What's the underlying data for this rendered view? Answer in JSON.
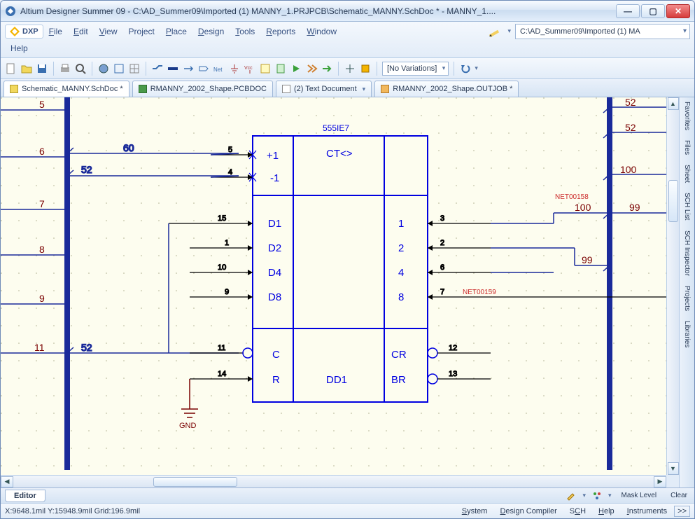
{
  "window": {
    "title": "Altium Designer Summer 09 - C:\\AD_Summer09\\Imported (1) MANNY_1.PRJPCB\\Schematic_MANNY.SchDoc * - MANNY_1...."
  },
  "menus": {
    "dxp": "DXP",
    "file": "File",
    "edit": "Edit",
    "view": "View",
    "project": "Project",
    "place": "Place",
    "design": "Design",
    "tools": "Tools",
    "reports": "Reports",
    "window": "Window",
    "help": "Help"
  },
  "path_field": "C:\\AD_Summer09\\Imported (1) MA",
  "variations": "[No Variations]",
  "tabs": {
    "t0": "Schematic_MANNY.SchDoc *",
    "t1": "RMANNY_2002_Shape.PCBDOC",
    "t2": "(2) Text Document",
    "t3": "RMANNY_2002_Shape.OUTJOB *"
  },
  "side_panels": {
    "favorites": "Favorites",
    "files": "Files",
    "sheet": "Sheet",
    "sch_list": "SCH List",
    "sch_inspector": "SCH Inspector",
    "projects": "Projects",
    "libraries": "Libraries"
  },
  "bottom_tab": "Editor",
  "bottom_right": {
    "mask": "Mask Level",
    "clear": "Clear"
  },
  "status": {
    "coords": "X:9648.1mil Y:15948.9mil   Grid:196.9mil",
    "system": "System",
    "design_compiler": "Design Compiler",
    "sch": "SCH",
    "help": "Help",
    "instruments": "Instruments",
    "more": ">>"
  },
  "schematic": {
    "designator": "555IE7",
    "component_ref": "DD1",
    "center_label": "CT<>",
    "gnd": "GND",
    "net_a": "NET00158",
    "net_b": "NET00159",
    "left_labels": {
      "plus1": "+1",
      "minus1": "-1",
      "d1": "D1",
      "d2": "D2",
      "d4": "D4",
      "d8": "D8",
      "c": "C",
      "r": "R"
    },
    "right_labels": {
      "o1": "1",
      "o2": "2",
      "o4": "4",
      "o8": "8",
      "cr": "CR",
      "br": "BR"
    },
    "pins": {
      "p5": "5",
      "p4": "4",
      "p15": "15",
      "p1": "1",
      "p10": "10",
      "p9": "9",
      "p11": "11",
      "p14": "14",
      "p3": "3",
      "p2": "2",
      "p6": "6",
      "p7": "7",
      "p12": "12",
      "p13": "13"
    },
    "bus_left": {
      "n5": "5",
      "n6": "6",
      "n7": "7",
      "n8": "8",
      "n9": "9",
      "n11": "11"
    },
    "bus_left_top": {
      "a60": "60",
      "a52": "52",
      "b52": "52"
    },
    "bus_right": {
      "r52a": "52",
      "r52b": "52",
      "r100a": "100",
      "r100b": "100",
      "r99a": "99",
      "r99b": "99"
    }
  }
}
